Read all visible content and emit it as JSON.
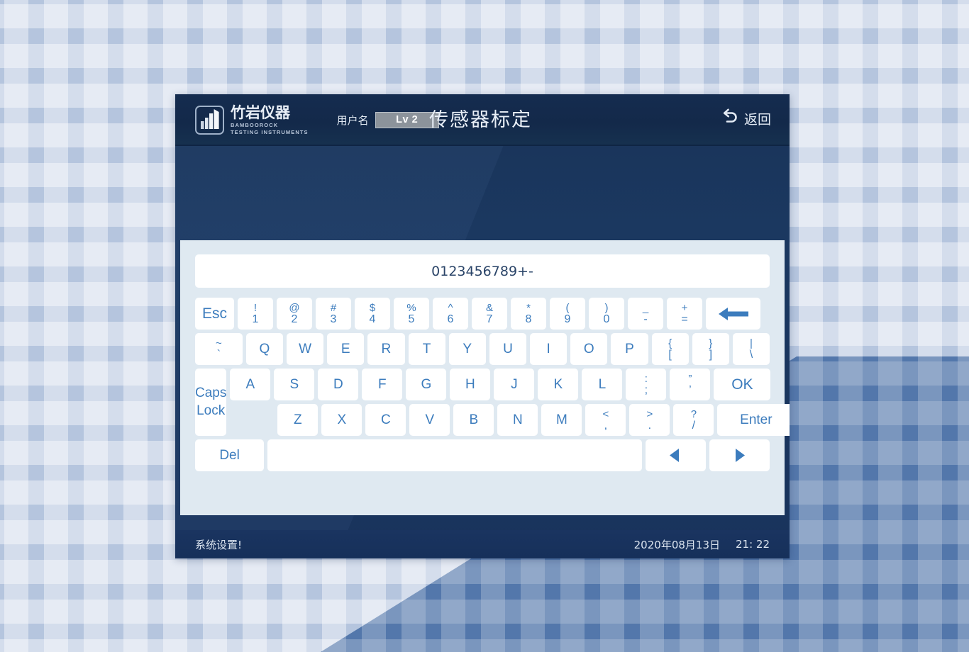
{
  "header": {
    "logo": {
      "icon": "building-bars-logo-icon",
      "cn_name": "竹岩仪器",
      "en_line1": "BAMBOOROCK",
      "en_line2": "TESTING INSTRUMENTS"
    },
    "user_label": "用户名",
    "user_badge": "Lv 2",
    "title": "传感器标定",
    "back": {
      "icon": "back-arrow-icon",
      "label": "返回"
    }
  },
  "keyboard": {
    "input_value": "0123456789+-",
    "input_placeholder": "",
    "row1": [
      {
        "name": "esc",
        "label": "Esc",
        "type": "word"
      },
      {
        "name": "1",
        "top": "!",
        "bot": "1"
      },
      {
        "name": "2",
        "top": "@",
        "bot": "2"
      },
      {
        "name": "3",
        "top": "#",
        "bot": "3"
      },
      {
        "name": "4",
        "top": "$",
        "bot": "4"
      },
      {
        "name": "5",
        "top": "%",
        "bot": "5"
      },
      {
        "name": "6",
        "top": "^",
        "bot": "6"
      },
      {
        "name": "7",
        "top": "&",
        "bot": "7"
      },
      {
        "name": "8",
        "top": "*",
        "bot": "8"
      },
      {
        "name": "9",
        "top": "(",
        "bot": "9"
      },
      {
        "name": "0",
        "top": ")",
        "bot": "0"
      },
      {
        "name": "minus",
        "top": "_",
        "bot": "-"
      },
      {
        "name": "equal",
        "top": "+",
        "bot": "="
      },
      {
        "name": "backspace",
        "icon": "backspace-arrow-icon",
        "type": "icon"
      }
    ],
    "row2": [
      {
        "name": "backquote",
        "top": "~",
        "bot": "`"
      },
      {
        "name": "q",
        "label": "Q"
      },
      {
        "name": "w",
        "label": "W"
      },
      {
        "name": "e",
        "label": "E"
      },
      {
        "name": "r",
        "label": "R"
      },
      {
        "name": "t",
        "label": "T"
      },
      {
        "name": "y",
        "label": "Y"
      },
      {
        "name": "u",
        "label": "U"
      },
      {
        "name": "i",
        "label": "I"
      },
      {
        "name": "o",
        "label": "O"
      },
      {
        "name": "p",
        "label": "P"
      },
      {
        "name": "bracket-left",
        "top": "{",
        "bot": "["
      },
      {
        "name": "bracket-right",
        "top": "}",
        "bot": "]"
      },
      {
        "name": "backslash",
        "top": "|",
        "bot": "\\"
      }
    ],
    "capslock": {
      "line1": "Caps",
      "line2": "Lock"
    },
    "row3": [
      {
        "name": "a",
        "label": "A"
      },
      {
        "name": "s",
        "label": "S"
      },
      {
        "name": "d",
        "label": "D"
      },
      {
        "name": "f",
        "label": "F"
      },
      {
        "name": "g",
        "label": "G"
      },
      {
        "name": "h",
        "label": "H"
      },
      {
        "name": "j",
        "label": "J"
      },
      {
        "name": "k",
        "label": "K"
      },
      {
        "name": "l",
        "label": "L"
      },
      {
        "name": "semicolon",
        "top": ":",
        "bot": ";"
      },
      {
        "name": "quote",
        "top": "”",
        "bot": "’"
      },
      {
        "name": "ok",
        "label": "OK",
        "type": "word"
      }
    ],
    "row4": [
      {
        "name": "z",
        "label": "Z"
      },
      {
        "name": "x",
        "label": "X"
      },
      {
        "name": "c",
        "label": "C"
      },
      {
        "name": "v",
        "label": "V"
      },
      {
        "name": "b",
        "label": "B"
      },
      {
        "name": "n",
        "label": "N"
      },
      {
        "name": "m",
        "label": "M"
      },
      {
        "name": "comma",
        "top": "<",
        "bot": ","
      },
      {
        "name": "period",
        "top": ">",
        "bot": "."
      },
      {
        "name": "slash",
        "top": "?",
        "bot": "/"
      },
      {
        "name": "enter",
        "label": "Enter",
        "type": "word"
      }
    ],
    "row5": [
      {
        "name": "del",
        "label": "Del",
        "type": "word"
      },
      {
        "name": "space",
        "label": "",
        "type": "space"
      },
      {
        "name": "arrow-left",
        "icon": "arrow-left-icon",
        "type": "icon"
      },
      {
        "name": "arrow-right",
        "icon": "arrow-right-icon",
        "type": "icon"
      }
    ]
  },
  "status": {
    "left": "系统设置!",
    "date": "2020年08月13日",
    "time": "21: 22"
  },
  "colors": {
    "header_bg": "#13294a",
    "body_bg": "#1c3a64",
    "panel_bg": "#dfe9f1",
    "key_bg": "#ffffff",
    "key_text": "#3c7cbd",
    "desktop_light": "#b5c5de",
    "desktop_dark": "#5377ab",
    "badge_bg": "#8c939b"
  }
}
